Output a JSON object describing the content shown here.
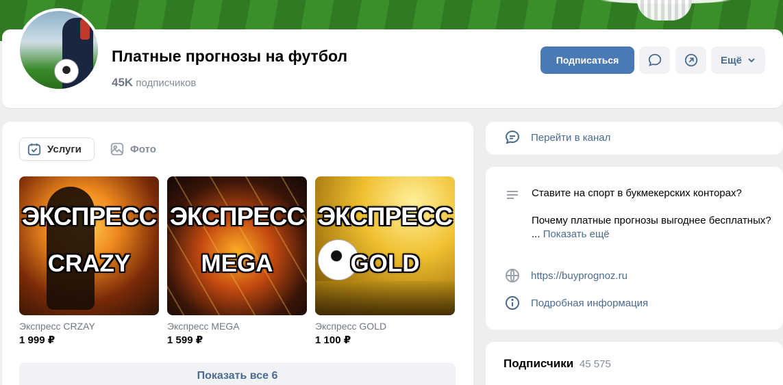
{
  "header": {
    "title": "Платные прогнозы на футбол",
    "subs_count": "45K",
    "subs_label": "подписчиков",
    "subscribe_label": "Подписаться",
    "more_label": "Ещё"
  },
  "tabs": [
    {
      "label": "Услуги",
      "icon": "calendar-check-icon",
      "active": true
    },
    {
      "label": "Фото",
      "icon": "photo-icon",
      "active": false
    }
  ],
  "products": [
    {
      "overlay_top": "ЭКСПРЕСС",
      "overlay_bottom": "CRAZY",
      "name": "Экспресс CRZAY",
      "price": "1 999 ₽"
    },
    {
      "overlay_top": "ЭКСПРЕСС",
      "overlay_bottom": "MEGA",
      "name": "Экспресс MEGA",
      "price": "1 599 ₽"
    },
    {
      "overlay_top": "ЭКСПРЕСС",
      "overlay_bottom": "GOLD",
      "name": "Экспресс GOLD",
      "price": "1 100 ₽"
    }
  ],
  "show_all_label": "Показать все 6",
  "sidebar": {
    "channel_label": "Перейти в канал",
    "description_line1": "Ставите на спорт в букмекерских конторах?",
    "description_line2": "Почему платные прогнозы выгоднее бесплатных?",
    "ellipsis": "...",
    "show_more_label": "Показать ещё",
    "website": "https://buyprognoz.ru",
    "details_label": "Подробная информация",
    "followers_label": "Подписчики",
    "followers_count": "45 575"
  },
  "colors": {
    "accent": "#4a7ab5",
    "link": "#4a6b8f",
    "background": "#edeef0"
  }
}
